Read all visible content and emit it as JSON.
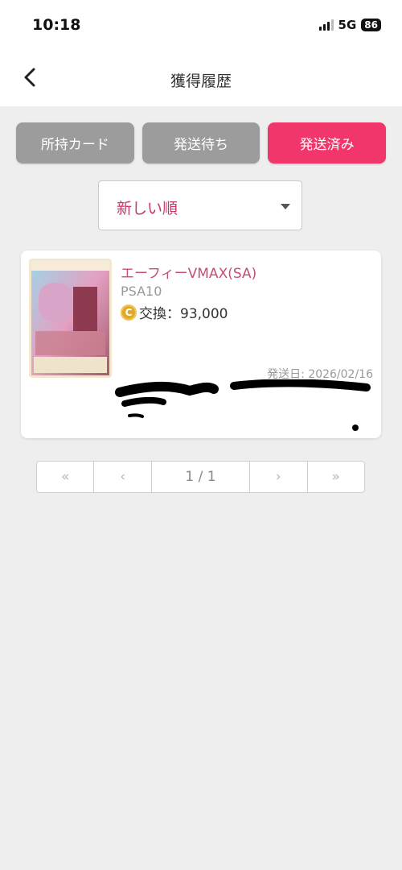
{
  "status": {
    "time": "10:18",
    "network": "5G",
    "battery": "86"
  },
  "header": {
    "title": "獲得履歴",
    "back_icon": "chevron-left-icon"
  },
  "tabs": [
    {
      "label": "所持カード",
      "active": false
    },
    {
      "label": "発送待ち",
      "active": false
    },
    {
      "label": "発送済み",
      "active": true
    }
  ],
  "sort": {
    "selected": "新しい順"
  },
  "items": [
    {
      "name": "エーフィーVMAX(SA)",
      "grade": "PSA10",
      "coin_icon": "C",
      "exchange": "交換：93,000",
      "ship_date": "発送日: 2026/02/16"
    }
  ],
  "pagination": {
    "first": "«",
    "prev": "‹",
    "current": "1 / 1",
    "next": "›",
    "last": "»"
  },
  "colors": {
    "accent": "#f0366b",
    "inactive_tab": "#9c9c9c",
    "name_text": "#c54d7c",
    "coin": "#e0a92b"
  }
}
